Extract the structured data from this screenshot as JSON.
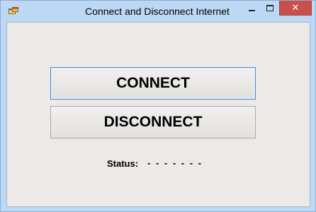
{
  "window": {
    "title": "Connect and Disconnect Internet",
    "close_symbol": "✕"
  },
  "buttons": {
    "connect_label": "CONNECT",
    "disconnect_label": "DISCONNECT"
  },
  "status": {
    "label": "Status:",
    "value": "- - - - - - -"
  },
  "icons": {
    "app": "app-window-icon",
    "minimize": "minimize-icon",
    "maximize": "maximize-icon",
    "close": "close-icon"
  },
  "colors": {
    "titlebar": "#bcd8f4",
    "close_button": "#c7504a",
    "client_background": "#ece9e6",
    "focus_border": "#3d8ad6"
  }
}
